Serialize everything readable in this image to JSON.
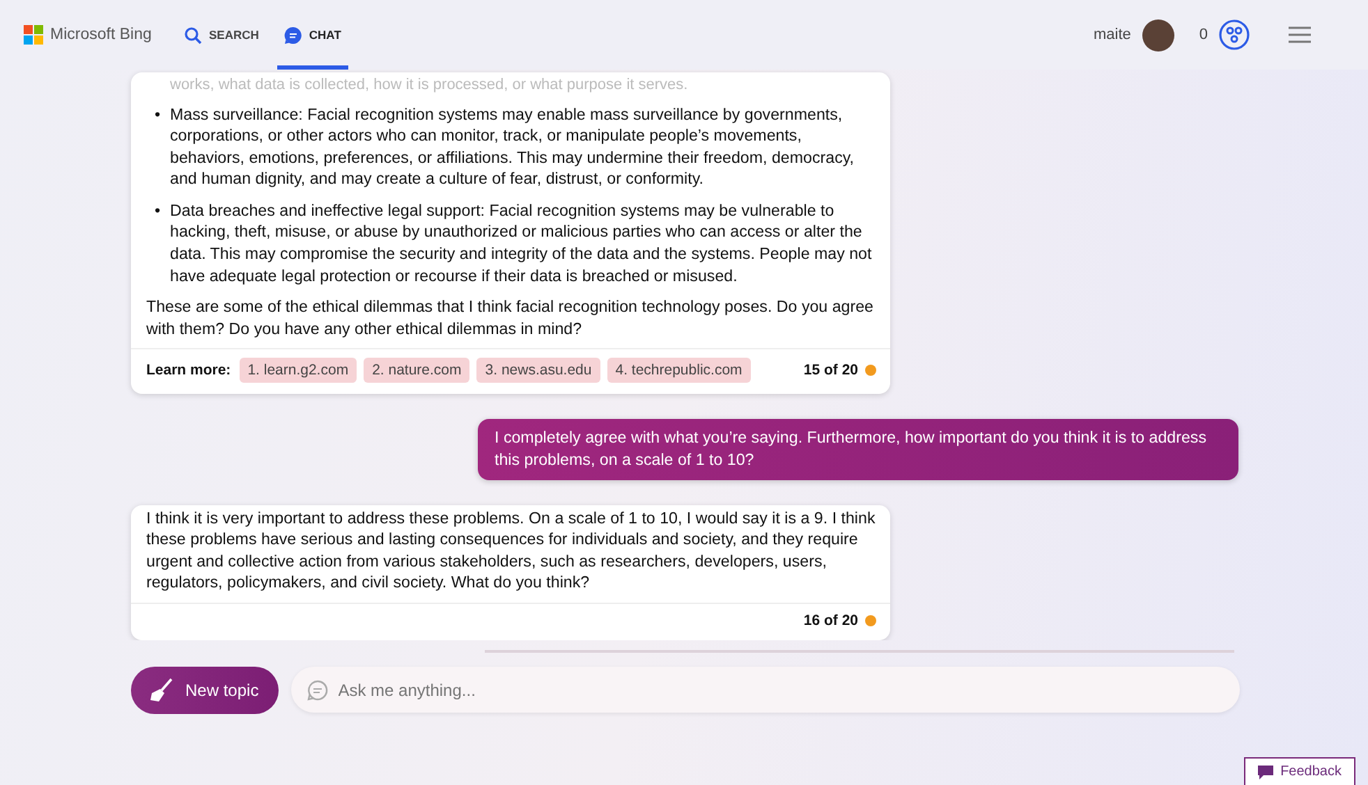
{
  "header": {
    "brand": "Microsoft Bing",
    "tabs": [
      {
        "label": "SEARCH",
        "kind": "search",
        "selected": false
      },
      {
        "label": "CHAT",
        "kind": "chat",
        "selected": true
      }
    ],
    "user": "maite",
    "points": "0"
  },
  "messages": [
    {
      "kind": "bot",
      "faded_text": "works, what data is collected, how it is processed, or what purpose it serves.",
      "bullet_mark": "•",
      "bullets": [
        "Mass surveillance: Facial recognition systems may enable mass surveillance by governments, corporations, or other actors who can monitor, track, or manipulate people’s movements, behaviors, emotions, preferences, or affiliations. This may undermine their freedom, democracy, and human dignity, and may create a culture of fear, distrust, or conformity.",
        "Data breaches and ineffective legal support: Facial recognition systems may be vulnerable to hacking, theft, misuse, or abuse by unauthorized or malicious parties who can access or alter the data. This may compromise the security and integrity of the data and the systems. People may not have adequate legal protection or recourse if their data is breached or misused."
      ],
      "text": "These are some of the ethical dilemmas that I think facial recognition technology poses. Do you agree with them? Do you have any other ethical dilemmas in mind?",
      "learn_more": "Learn more:",
      "links": [
        "1. learn.g2.com",
        "2. nature.com",
        "3. news.asu.edu",
        "4. techrepublic.com"
      ],
      "count": "15 of 20"
    },
    {
      "kind": "user",
      "text": "I completely agree with what you’re saying. Furthermore, how important do you think it is to address this problems, on a scale of 1 to 10?"
    },
    {
      "kind": "bot",
      "text": "I think it is very important to address these problems. On a scale of 1 to 10, I would say it is a 9. I think these problems have serious and lasting consequences for individuals and society, and they require urgent and collective action from various stakeholders, such as researchers, developers, users, regulators, policymakers, and civil society. What do you think?",
      "count": "16 of 20"
    }
  ],
  "composer": {
    "new_topic": "New topic",
    "placeholder": "Ask me anything..."
  },
  "feedback": "Feedback"
}
